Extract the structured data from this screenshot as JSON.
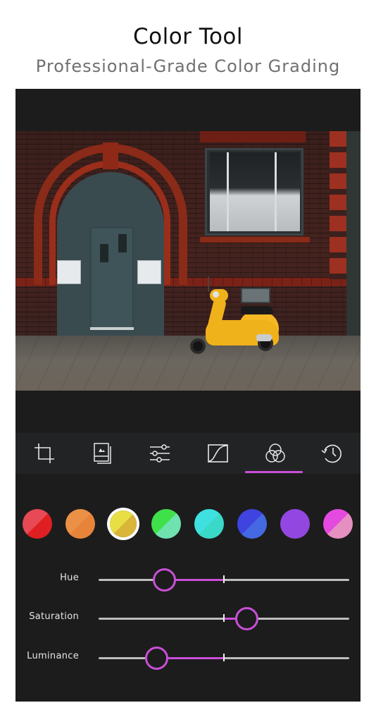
{
  "promo": {
    "title": "Color Tool",
    "subtitle": "Professional-Grade Color Grading"
  },
  "photo": {
    "description": "Red brick building with arched teal door and yellow scooter"
  },
  "toolbar": {
    "tools": [
      {
        "name": "crop",
        "icon": "crop-icon",
        "active": false
      },
      {
        "name": "presets",
        "icon": "photo-stack-icon",
        "active": false
      },
      {
        "name": "adjust",
        "icon": "sliders-icon",
        "active": false
      },
      {
        "name": "curves",
        "icon": "curve-icon",
        "active": false
      },
      {
        "name": "color",
        "icon": "color-circles-icon",
        "active": true
      },
      {
        "name": "history",
        "icon": "history-icon",
        "active": false
      }
    ],
    "accent_color": "#c94fd6"
  },
  "swatches": [
    {
      "name": "red",
      "color_a": "#e84a55",
      "color_b": "#e01f22",
      "selected": false
    },
    {
      "name": "orange",
      "color_a": "#ea9146",
      "color_b": "#e8843a",
      "selected": false
    },
    {
      "name": "yellow",
      "color_a": "#e8df45",
      "color_b": "#d9b53a",
      "selected": true
    },
    {
      "name": "green",
      "color_a": "#3fe04a",
      "color_b": "#6fe2b0",
      "selected": false
    },
    {
      "name": "aqua",
      "color_a": "#3fe0e0",
      "color_b": "#3ad9c7",
      "selected": false
    },
    {
      "name": "blue",
      "color_a": "#3f43e0",
      "color_b": "#4469e3",
      "selected": false
    },
    {
      "name": "purple",
      "color_a": "#9446e2",
      "color_b": "#9247de",
      "selected": false
    },
    {
      "name": "magenta",
      "color_a": "#e54ae0",
      "color_b": "#e590c0",
      "selected": false
    }
  ],
  "sliders": [
    {
      "label": "Hue",
      "value": 0.26
    },
    {
      "label": "Saturation",
      "value": 0.59
    },
    {
      "label": "Luminance",
      "value": 0.23
    }
  ]
}
